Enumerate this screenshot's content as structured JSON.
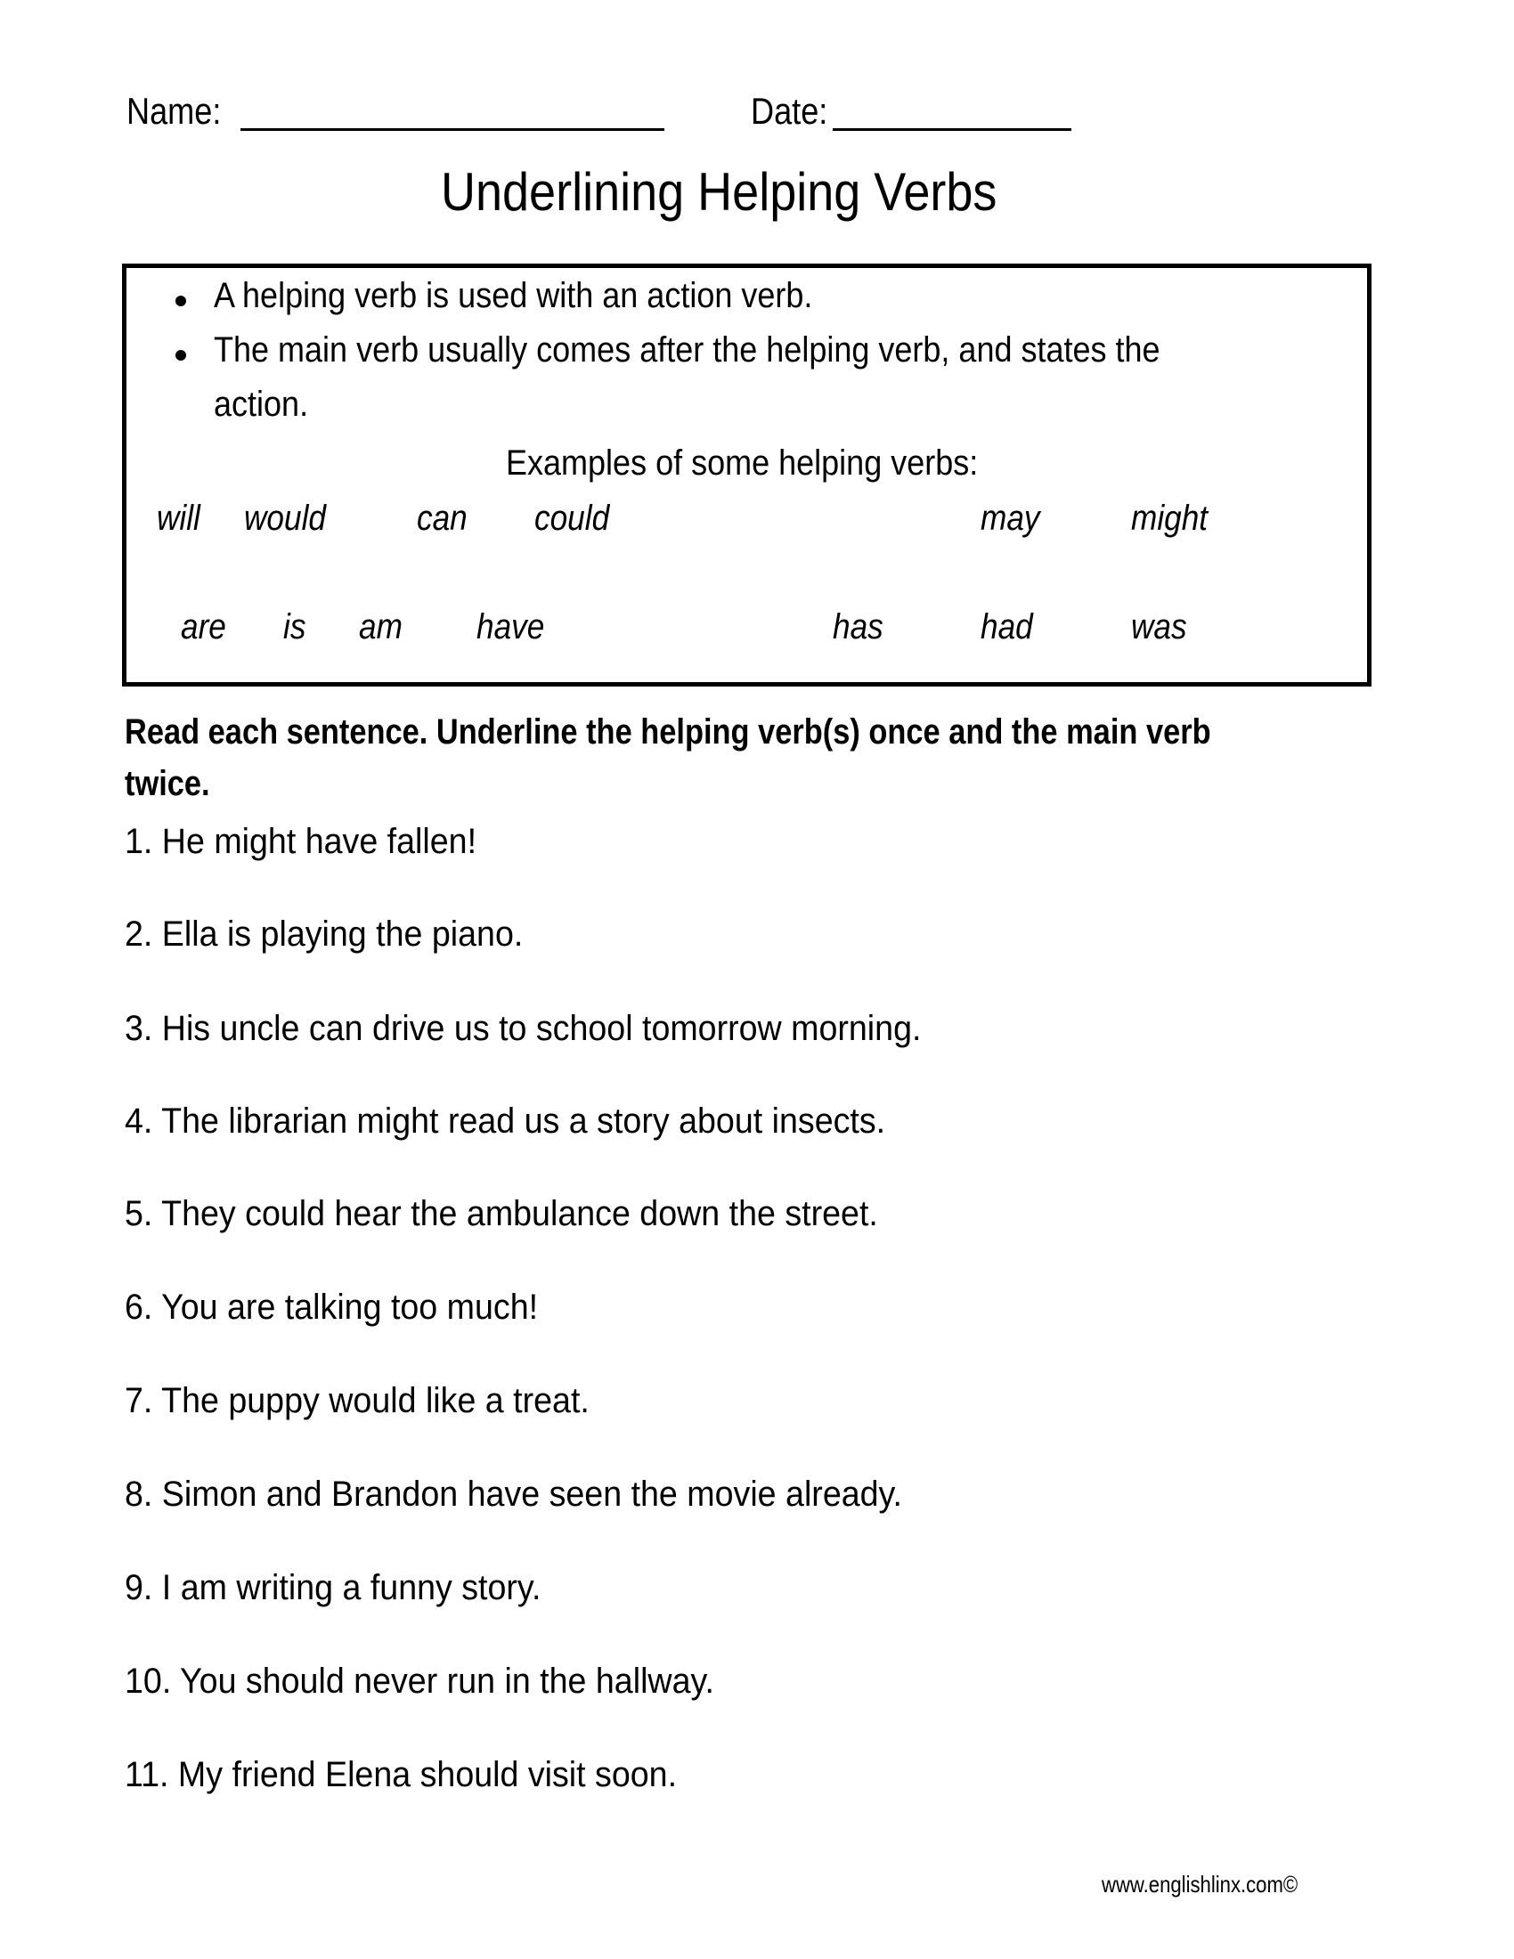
{
  "header": {
    "name_label": "Name:",
    "date_label": "Date:"
  },
  "title": "Underlining Helping Verbs",
  "info_box": {
    "bullets": [
      "A helping verb is used with an action verb.",
      "The main verb usually comes after the helping verb, and states the",
      "action."
    ],
    "examples_heading": "Examples of some helping verbs:",
    "verbs_row1": [
      "will",
      "would",
      "can",
      "could",
      "may",
      "might"
    ],
    "verbs_row2": [
      "are",
      "is",
      "am",
      "have",
      "has",
      "had",
      "was"
    ]
  },
  "instructions": {
    "line1": "Read each sentence. Underline the helping verb(s) once and the main verb",
    "line2": "twice."
  },
  "sentences": [
    "1. He might have fallen!",
    "2. Ella is playing the piano.",
    "3. His uncle can drive us to school tomorrow morning.",
    "4. The librarian might read us a story about insects.",
    "5. They could hear the ambulance down the street.",
    "6. You are talking too much!",
    "7. The puppy would like a treat.",
    "8. Simon and Brandon have seen the movie already.",
    "9. I am writing a funny story.",
    "10. You should never run in the hallway.",
    "11. My friend Elena should visit soon."
  ],
  "footer": "www.englishlinx.com©"
}
